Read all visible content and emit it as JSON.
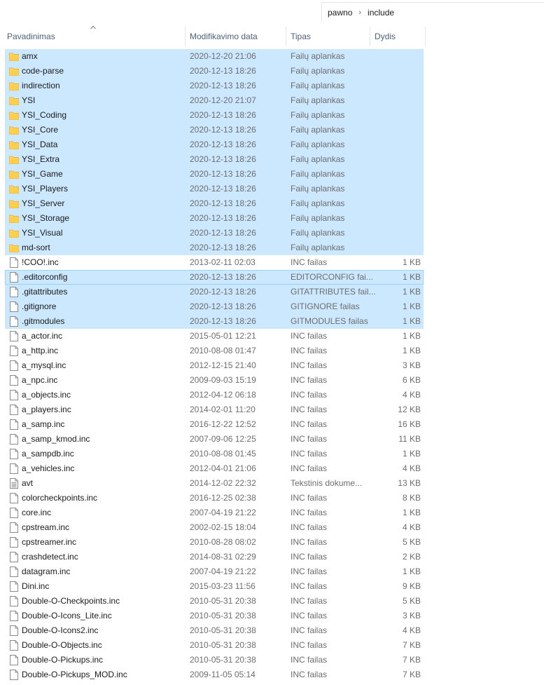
{
  "breadcrumb": {
    "parts": [
      "pawno",
      "include"
    ]
  },
  "columns": {
    "name": "Pavadinimas",
    "date": "Modifikavimo data",
    "type": "Tipas",
    "size": "Dydis"
  },
  "files": [
    {
      "name": "amx",
      "date": "2020-12-20 21:06",
      "type": "Failų aplankas",
      "size": "",
      "kind": "folder",
      "selected": true
    },
    {
      "name": "code-parse",
      "date": "2020-12-13 18:26",
      "type": "Failų aplankas",
      "size": "",
      "kind": "folder",
      "selected": true
    },
    {
      "name": "indirection",
      "date": "2020-12-13 18:26",
      "type": "Failų aplankas",
      "size": "",
      "kind": "folder",
      "selected": true
    },
    {
      "name": "YSI",
      "date": "2020-12-20 21:07",
      "type": "Failų aplankas",
      "size": "",
      "kind": "folder",
      "selected": true
    },
    {
      "name": "YSI_Coding",
      "date": "2020-12-13 18:26",
      "type": "Failų aplankas",
      "size": "",
      "kind": "folder",
      "selected": true
    },
    {
      "name": "YSI_Core",
      "date": "2020-12-13 18:26",
      "type": "Failų aplankas",
      "size": "",
      "kind": "folder",
      "selected": true
    },
    {
      "name": "YSI_Data",
      "date": "2020-12-13 18:26",
      "type": "Failų aplankas",
      "size": "",
      "kind": "folder",
      "selected": true
    },
    {
      "name": "YSI_Extra",
      "date": "2020-12-13 18:26",
      "type": "Failų aplankas",
      "size": "",
      "kind": "folder",
      "selected": true
    },
    {
      "name": "YSI_Game",
      "date": "2020-12-13 18:26",
      "type": "Failų aplankas",
      "size": "",
      "kind": "folder",
      "selected": true
    },
    {
      "name": "YSI_Players",
      "date": "2020-12-13 18:26",
      "type": "Failų aplankas",
      "size": "",
      "kind": "folder",
      "selected": true
    },
    {
      "name": "YSI_Server",
      "date": "2020-12-13 18:26",
      "type": "Failų aplankas",
      "size": "",
      "kind": "folder",
      "selected": true
    },
    {
      "name": "YSI_Storage",
      "date": "2020-12-13 18:26",
      "type": "Failų aplankas",
      "size": "",
      "kind": "folder",
      "selected": true
    },
    {
      "name": "YSI_Visual",
      "date": "2020-12-13 18:26",
      "type": "Failų aplankas",
      "size": "",
      "kind": "folder",
      "selected": true
    },
    {
      "name": "md-sort",
      "date": "2020-12-13 18:26",
      "type": "Failų aplankas",
      "size": "",
      "kind": "folder",
      "selected": true
    },
    {
      "name": "!COO!.inc",
      "date": "2013-02-11 02:03",
      "type": "INC failas",
      "size": "1 KB",
      "kind": "file",
      "selected": false
    },
    {
      "name": ".editorconfig",
      "date": "2020-12-13 18:26",
      "type": "EDITORCONFIG fai...",
      "size": "1 KB",
      "kind": "file",
      "selected": true,
      "cursor": true
    },
    {
      "name": ".gitattributes",
      "date": "2020-12-13 18:26",
      "type": "GITATTRIBUTES fail...",
      "size": "1 KB",
      "kind": "file",
      "selected": true
    },
    {
      "name": ".gitignore",
      "date": "2020-12-13 18:26",
      "type": "GITIGNORE failas",
      "size": "1 KB",
      "kind": "file",
      "selected": true
    },
    {
      "name": ".gitmodules",
      "date": "2020-12-13 18:26",
      "type": "GITMODULES failas",
      "size": "1 KB",
      "kind": "file",
      "selected": true
    },
    {
      "name": "a_actor.inc",
      "date": "2015-05-01 12:21",
      "type": "INC failas",
      "size": "1 KB",
      "kind": "file",
      "selected": false
    },
    {
      "name": "a_http.inc",
      "date": "2010-08-08 01:47",
      "type": "INC failas",
      "size": "1 KB",
      "kind": "file",
      "selected": false
    },
    {
      "name": "a_mysql.inc",
      "date": "2012-12-15 21:40",
      "type": "INC failas",
      "size": "3 KB",
      "kind": "file",
      "selected": false
    },
    {
      "name": "a_npc.inc",
      "date": "2009-09-03 15:19",
      "type": "INC failas",
      "size": "6 KB",
      "kind": "file",
      "selected": false
    },
    {
      "name": "a_objects.inc",
      "date": "2012-04-12 06:18",
      "type": "INC failas",
      "size": "4 KB",
      "kind": "file",
      "selected": false
    },
    {
      "name": "a_players.inc",
      "date": "2014-02-01 11:20",
      "type": "INC failas",
      "size": "12 KB",
      "kind": "file",
      "selected": false
    },
    {
      "name": "a_samp.inc",
      "date": "2016-12-22 12:52",
      "type": "INC failas",
      "size": "16 KB",
      "kind": "file",
      "selected": false
    },
    {
      "name": "a_samp_kmod.inc",
      "date": "2007-09-06 12:25",
      "type": "INC failas",
      "size": "11 KB",
      "kind": "file",
      "selected": false
    },
    {
      "name": "a_sampdb.inc",
      "date": "2010-08-08 01:45",
      "type": "INC failas",
      "size": "1 KB",
      "kind": "file",
      "selected": false
    },
    {
      "name": "a_vehicles.inc",
      "date": "2012-04-01 21:06",
      "type": "INC failas",
      "size": "4 KB",
      "kind": "file",
      "selected": false
    },
    {
      "name": "avt",
      "date": "2014-12-02 22:32",
      "type": "Tekstinis dokume...",
      "size": "13 KB",
      "kind": "text",
      "selected": false
    },
    {
      "name": "colorcheckpoints.inc",
      "date": "2016-12-25 02:38",
      "type": "INC failas",
      "size": "8 KB",
      "kind": "file",
      "selected": false
    },
    {
      "name": "core.inc",
      "date": "2007-04-19 21:22",
      "type": "INC failas",
      "size": "1 KB",
      "kind": "file",
      "selected": false
    },
    {
      "name": "cpstream.inc",
      "date": "2002-02-15 18:04",
      "type": "INC failas",
      "size": "4 KB",
      "kind": "file",
      "selected": false
    },
    {
      "name": "cpstreamer.inc",
      "date": "2010-08-28 08:02",
      "type": "INC failas",
      "size": "5 KB",
      "kind": "file",
      "selected": false
    },
    {
      "name": "crashdetect.inc",
      "date": "2014-08-31 02:29",
      "type": "INC failas",
      "size": "2 KB",
      "kind": "file",
      "selected": false
    },
    {
      "name": "datagram.inc",
      "date": "2007-04-19 21:22",
      "type": "INC failas",
      "size": "1 KB",
      "kind": "file",
      "selected": false
    },
    {
      "name": "Dini.inc",
      "date": "2015-03-23 11:56",
      "type": "INC failas",
      "size": "9 KB",
      "kind": "file",
      "selected": false
    },
    {
      "name": "Double-O-Checkpoints.inc",
      "date": "2010-05-31 20:38",
      "type": "INC failas",
      "size": "5 KB",
      "kind": "file",
      "selected": false
    },
    {
      "name": "Double-O-Icons_Lite.inc",
      "date": "2010-05-31 20:38",
      "type": "INC failas",
      "size": "3 KB",
      "kind": "file",
      "selected": false
    },
    {
      "name": "Double-O-Icons2.inc",
      "date": "2010-05-31 20:38",
      "type": "INC failas",
      "size": "4 KB",
      "kind": "file",
      "selected": false
    },
    {
      "name": "Double-O-Objects.inc",
      "date": "2010-05-31 20:38",
      "type": "INC failas",
      "size": "7 KB",
      "kind": "file",
      "selected": false
    },
    {
      "name": "Double-O-Pickups.inc",
      "date": "2010-05-31 20:38",
      "type": "INC failas",
      "size": "7 KB",
      "kind": "file",
      "selected": false
    },
    {
      "name": "Double-O-Pickups_MOD.inc",
      "date": "2009-11-05 05:14",
      "type": "INC failas",
      "size": "7 KB",
      "kind": "file",
      "selected": false
    }
  ]
}
